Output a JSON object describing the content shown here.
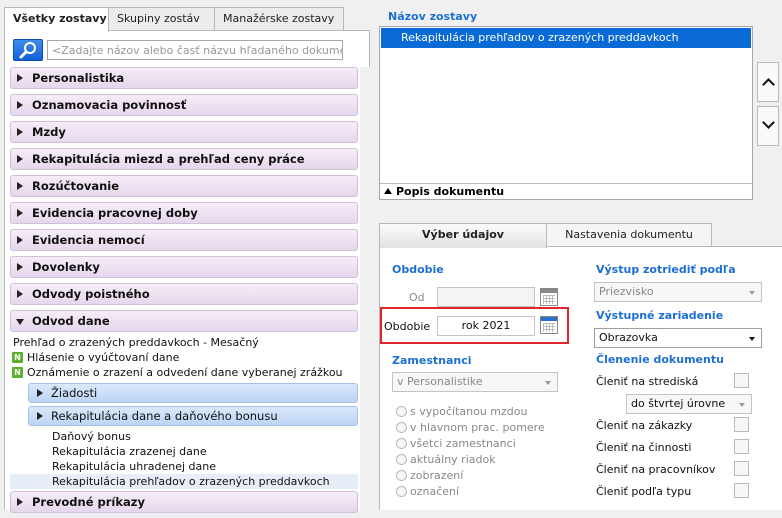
{
  "left_tabs": [
    "Všetky zostavy",
    "Skupiny zostáv",
    "Manažérske zostavy"
  ],
  "search": {
    "placeholder": "<Zadajte názov alebo časť názvu hľadaného dokumentu>"
  },
  "categories_top": [
    "Personalistika",
    "Oznamovacia povinnosť",
    "Mzdy",
    "Rekapitulácia miezd a prehľad ceny práce",
    "Rozúčtovanie",
    "Evidencia pracovnej doby",
    "Evidencia nemocí",
    "Dovolenky",
    "Odvody poistného"
  ],
  "open_category": {
    "label": "Odvod dane",
    "items": [
      {
        "label": "Prehľad o zrazených  preddavkoch - Mesačný",
        "badge": ""
      },
      {
        "label": "Hlásenie o vyúčtovaní dane",
        "badge": "N"
      },
      {
        "label": "Oznámenie o zrazení a odvedení dane vyberanej zrážkou",
        "badge": "N"
      }
    ],
    "subcategories": [
      {
        "label": "Žiadosti",
        "leaves": []
      },
      {
        "label": "Rekapitulácia dane a daňového bonusu",
        "leaves": [
          "Daňový bonus",
          "Rekapitulácia zrazenej dane",
          "Rekapitulácia uhradenej dane",
          "Rekapitulácia prehľadov o zrazených preddavkoch"
        ]
      }
    ]
  },
  "categories_bottom": [
    "Prevodné príkazy"
  ],
  "report": {
    "title": "Názov zostavy",
    "selected": "Rekapitulácia prehľadov o zrazených preddavkoch",
    "popis": "Popis dokumentu"
  },
  "right_tabs": [
    "Výber údajov",
    "Nastavenia dokumentu"
  ],
  "form": {
    "obdobie_title": "Obdobie",
    "od_label": "Od",
    "od_value": "",
    "obdobie_label": "Obdobie",
    "obdobie_value": "rok 2021",
    "zamestnanci_title": "Zamestnanci",
    "zamestnanci_value": "v Personalistike",
    "radios": [
      "s vypočítanou mzdou",
      "v hlavnom prac. pomere",
      "všetci zamestnanci",
      "aktuálny riadok",
      "zobrazení",
      "označení"
    ],
    "vystup_title": "Výstup zotriediť podľa",
    "vystup_value": "Priezvisko",
    "zariadenie_title": "Výstupné zariadenie",
    "zariadenie_value": "Obrazovka",
    "clenenie_title": "Členenie dokumentu",
    "clenenie_items": [
      "Členiť na strediská",
      "Členiť na zákazky",
      "Členiť na činnosti",
      "Členiť na pracovníkov",
      "Členiť podľa typu"
    ],
    "uroven_value": "do štvrtej úrovne"
  },
  "colors": {
    "accent": "#1d6fd1",
    "selection": "#0a6ad6",
    "highlight_border": "#e0262e"
  }
}
